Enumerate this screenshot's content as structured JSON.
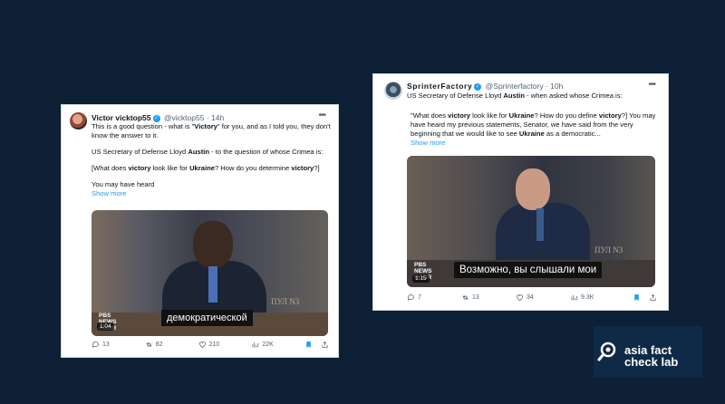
{
  "tweet1": {
    "name": "Victor vicktop55",
    "handle": "@vicktop55",
    "time": "· 14h",
    "p1_a": "This is a good question - what is \"",
    "p1_b": "Victory",
    "p1_c": "\" for you, and as I told you, they don't know the answer to it.",
    "p2_a": "US Secretary of Defense Lloyd ",
    "p2_b": "Austin",
    "p2_c": " - to the question of whose Crimea is:",
    "p3_a": "[What does ",
    "p3_b": "victory",
    "p3_c": " look like for ",
    "p3_d": "Ukraine",
    "p3_e": "? How do you determine ",
    "p3_f": "victory",
    "p3_g": "?]",
    "p4": "You may have heard",
    "show_more": "Show more",
    "video_caption": "демократической",
    "video_time": "1:04",
    "watermark": "ПУЛ N3",
    "logo": "PBS NEWS HOUR",
    "replies": "13",
    "retweets": "82",
    "likes": "210",
    "views": "22K"
  },
  "tweet2": {
    "name": "SprinterFactory",
    "handle": "@Sprinterfactory",
    "time": "· 10h",
    "line1_a": "US Secretary of Defense Lloyd ",
    "line1_b": "Austin",
    "line1_c": " - when asked whose Crimea is:",
    "q_a": "\"What does ",
    "q_b": "victory",
    "q_c": " look like for ",
    "q_d": "Ukraine",
    "q_e": "? How do you define ",
    "q_f": "victory",
    "q_g": "?] You may have heard my previous statements, Senator, we have said from the very beginning that we would like to see ",
    "q_h": "Ukraine",
    "q_i": " as a democratic...",
    "show_more": "Show more",
    "video_caption": "Возможно, вы слышали мои",
    "video_time": "1:15",
    "watermark": "ПУЛ N3",
    "logo": "PBS NEWS HOUR",
    "replies": "7",
    "retweets": "13",
    "likes": "34",
    "views": "9.3K"
  },
  "afcl": {
    "line1": "asia fact",
    "line2": "check lab"
  },
  "colors": {
    "background": "#0d2036",
    "link": "#1d9bf0",
    "bookmark": "#1d9bf0"
  }
}
